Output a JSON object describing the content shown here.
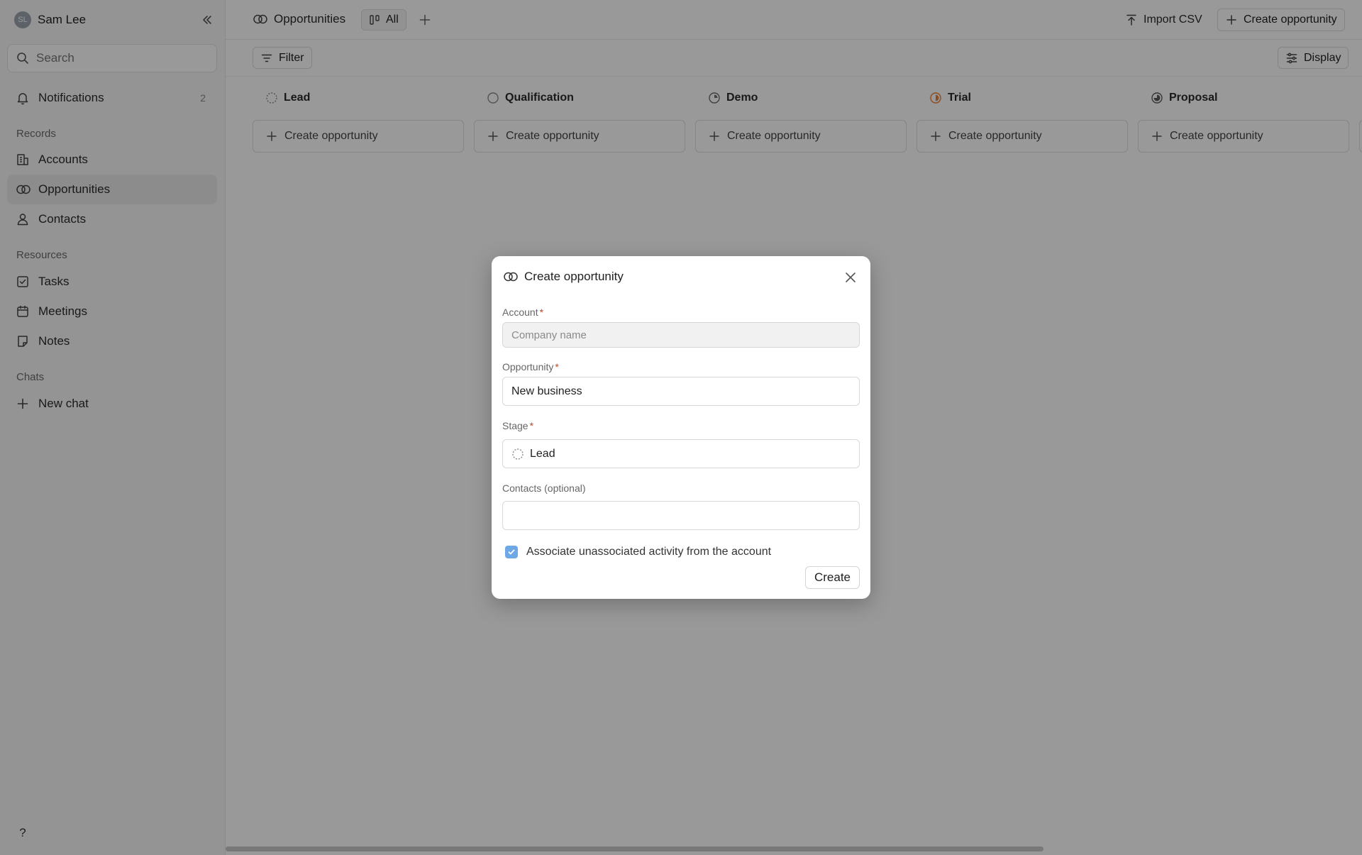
{
  "user": {
    "initials": "SL",
    "name": "Sam Lee"
  },
  "sidebar": {
    "search_placeholder": "Search",
    "notifications": {
      "label": "Notifications",
      "count": "2"
    },
    "records_label": "Records",
    "records": [
      {
        "label": "Accounts",
        "icon": "building-icon"
      },
      {
        "label": "Opportunities",
        "icon": "opportunities-icon",
        "active": true
      },
      {
        "label": "Contacts",
        "icon": "person-icon"
      }
    ],
    "resources_label": "Resources",
    "resources": [
      {
        "label": "Tasks",
        "icon": "checkbox-icon"
      },
      {
        "label": "Meetings",
        "icon": "calendar-icon"
      },
      {
        "label": "Notes",
        "icon": "note-icon"
      }
    ],
    "chats_label": "Chats",
    "new_chat": "New chat",
    "help": "?"
  },
  "header": {
    "title": "Opportunities",
    "view_tab": "All",
    "import_csv": "Import CSV",
    "create_opportunity": "Create opportunity"
  },
  "toolbar": {
    "filter": "Filter",
    "display": "Display"
  },
  "board": {
    "create_label": "Create opportunity",
    "columns": [
      {
        "name": "Lead",
        "icon": "lead-dashed-circle-icon"
      },
      {
        "name": "Qualification",
        "icon": "empty-circle-icon"
      },
      {
        "name": "Demo",
        "icon": "quarter-circle-icon"
      },
      {
        "name": "Trial",
        "icon": "half-circle-orange-icon",
        "color": "#e8813a"
      },
      {
        "name": "Proposal",
        "icon": "three-quarter-circle-icon"
      }
    ]
  },
  "modal": {
    "title": "Create opportunity",
    "account_label": "Account",
    "account_placeholder": "Company name",
    "opportunity_label": "Opportunity",
    "opportunity_value": "New business",
    "stage_label": "Stage",
    "stage_value": "Lead",
    "contacts_label": "Contacts (optional)",
    "contacts_value": "",
    "associate_label": "Associate unassociated activity from the account",
    "associate_checked": true,
    "submit_label": "Create",
    "required_mark": "*"
  },
  "colors": {
    "accent_checkbox": "#6ea8e6",
    "required": "#c0492c",
    "trial": "#e8813a"
  }
}
